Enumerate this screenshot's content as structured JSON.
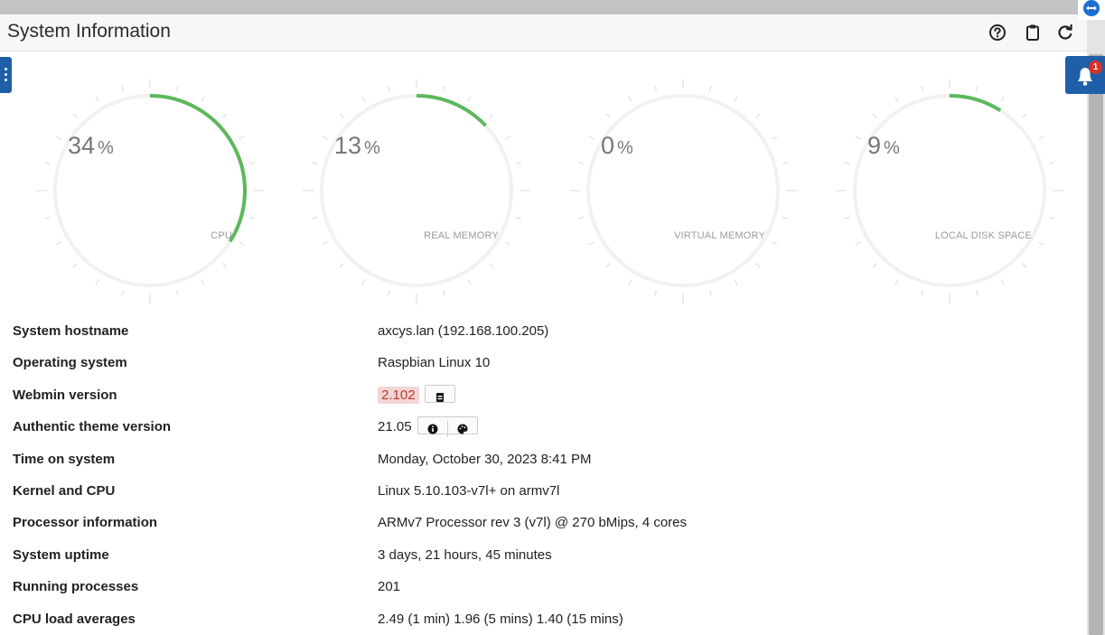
{
  "header": {
    "title": "System Information"
  },
  "gauges": [
    {
      "value": "34",
      "unit": "%",
      "label": "CPU",
      "fraction": 0.34,
      "color": "#5cb85c"
    },
    {
      "value": "13",
      "unit": "%",
      "label": "REAL MEMORY",
      "fraction": 0.13,
      "color": "#5cb85c"
    },
    {
      "value": "0",
      "unit": "%",
      "label": "VIRTUAL MEMORY",
      "fraction": 0.0,
      "color": "#5cb85c"
    },
    {
      "value": "9",
      "unit": "%",
      "label": "LOCAL DISK SPACE",
      "fraction": 0.09,
      "color": "#5cb85c"
    }
  ],
  "notifications": {
    "count": "1"
  },
  "info": {
    "hostname_label": "System hostname",
    "hostname_value": "axcys.lan (192.168.100.205)",
    "os_label": "Operating system",
    "os_value": "Raspbian Linux 10",
    "webmin_label": "Webmin version",
    "webmin_value": "2.102",
    "theme_label": "Authentic theme version",
    "theme_value": "21.05",
    "time_label": "Time on system",
    "time_value": "Monday, October 30, 2023 8:41 PM",
    "kernel_label": "Kernel and CPU",
    "kernel_value": "Linux 5.10.103-v7l+ on armv7l",
    "proc_label": "Processor information",
    "proc_value": "ARMv7 Processor rev 3 (v7l) @ 270 bMips, 4 cores",
    "uptime_label": "System uptime",
    "uptime_value": "3 days, 21 hours, 45 minutes",
    "running_label": "Running processes",
    "running_value": "201",
    "load_label": "CPU load averages",
    "load_value": "2.49 (1 min) 1.96 (5 mins) 1.40 (15 mins)"
  },
  "colors": {
    "accent_blue": "#1f5fa8",
    "link": "#2a6ebb",
    "gauge_green": "#5cb85c",
    "badge_red": "#d9302a"
  }
}
